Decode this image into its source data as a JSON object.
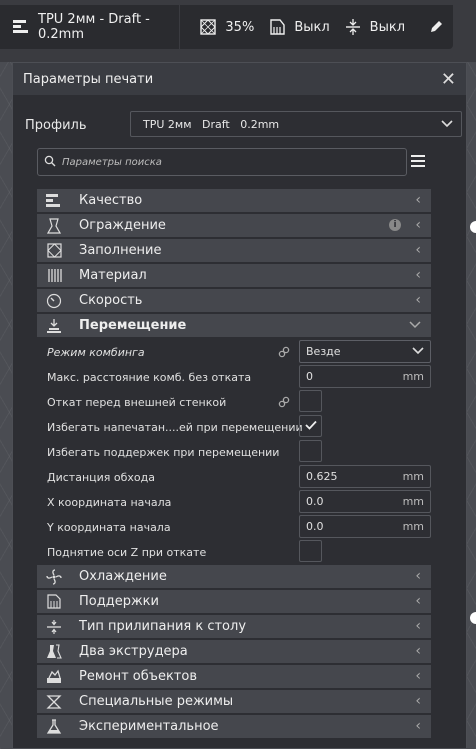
{
  "topbar": {
    "profile_text": "TPU 2мм - Draft - 0.2mm",
    "infill_value": "35%",
    "support_value": "Выкл",
    "adhesion_value": "Выкл"
  },
  "dialog": {
    "title": "Параметры печати",
    "close_label": "✕",
    "profile_label": "Профиль",
    "profile_value": "TPU 2мм   Draft   0.2mm",
    "search_placeholder": "Параметры поиска"
  },
  "categories_top": [
    {
      "label": "Качество",
      "icon": "quality-icon"
    },
    {
      "label": "Ограждение",
      "icon": "shell-icon"
    },
    {
      "label": "Заполнение",
      "icon": "infill-icon"
    },
    {
      "label": "Материал",
      "icon": "material-icon"
    },
    {
      "label": "Скорость",
      "icon": "speed-icon"
    },
    {
      "label": "Перемещение",
      "icon": "travel-icon"
    }
  ],
  "travel_settings": [
    {
      "label": "Режим комбинга",
      "value": "Везде",
      "unit": ""
    },
    {
      "label": "Макс. расстояние комб. без отката",
      "value": "0",
      "unit": "mm"
    },
    {
      "label": "Откат перед внешней стенкой"
    },
    {
      "label": "Избегать напечатан....ей при перемещении"
    },
    {
      "label": "Избегать поддержек при перемещении"
    },
    {
      "label": "Дистанция обхода",
      "value": "0.625",
      "unit": "mm"
    },
    {
      "label": "X координата начала",
      "value": "0.0",
      "unit": "mm"
    },
    {
      "label": "Y координата начала",
      "value": "0.0",
      "unit": "mm"
    },
    {
      "label": "Поднятие оси Z при откате"
    }
  ],
  "categories_bottom": [
    {
      "label": "Охлаждение",
      "icon": "cooling-icon"
    },
    {
      "label": "Поддержки",
      "icon": "support-icon"
    },
    {
      "label": "Тип прилипания к столу",
      "icon": "adhesion-icon"
    },
    {
      "label": "Два экструдера",
      "icon": "dual-extrusion-icon"
    },
    {
      "label": "Ремонт объектов",
      "icon": "mesh-fix-icon"
    },
    {
      "label": "Специальные режимы",
      "icon": "special-modes-icon"
    },
    {
      "label": "Экспериментальное",
      "icon": "experimental-icon"
    }
  ],
  "checkbox_states": {
    "retract_before_wall": false,
    "avoid_printed": true,
    "avoid_supports": false,
    "z_hop": false
  }
}
